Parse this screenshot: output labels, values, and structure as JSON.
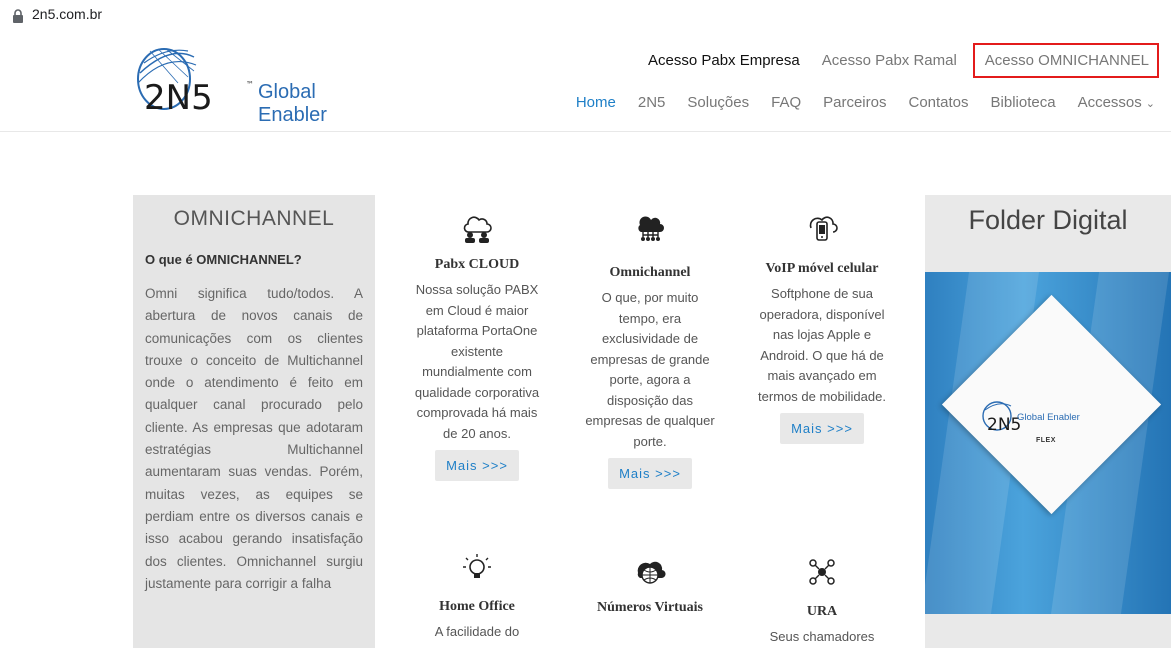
{
  "browser": {
    "url": "2n5.com.br"
  },
  "logo": {
    "brand": "2N5",
    "tagline": "Global Enabler"
  },
  "top_links": [
    "Acesso Pabx Empresa",
    "Acesso Pabx Ramal",
    "Acesso OMNICHANNEL"
  ],
  "nav": [
    "Home",
    "2N5",
    "Soluções",
    "FAQ",
    "Parceiros",
    "Contatos",
    "Biblioteca",
    "Accessos"
  ],
  "left": {
    "title": "OMNICHANNEL",
    "question": "O que é OMNICHANNEL?",
    "body": "Omni significa tudo/todos. A abertura de novos canais de comunicações com os clientes trouxe o conceito de Multichannel onde o atendimento é feito em qualquer canal procurado pelo cliente. As empresas que adotaram estratégias Multichannel aumentaram suas vendas. Porém, muitas vezes, as equipes se perdiam entre os diversos canais e isso acabou gerando insatisfação dos clientes. Omnichannel surgiu justamente para corrigir a falha"
  },
  "cards": [
    {
      "title": "Pabx CLOUD",
      "text": "Nossa solução PABX em Cloud é maior plataforma PortaOne existente mundialmente com qualidade corporativa comprovada há mais de 20 anos.",
      "more": "Mais >>>",
      "icon": "cloud-users-icon"
    },
    {
      "title": "Omnichannel",
      "text": "O que, por muito tempo, era exclusividade de empresas de grande porte, agora a disposição das empresas de qualquer porte.",
      "more": "Mais >>>",
      "icon": "cloud-network-icon"
    },
    {
      "title": "VoIP móvel celular",
      "text": "Softphone de sua operadora, disponível nas lojas Apple e Android. O que há de mais avançado em termos de mobilidade.",
      "more": "Mais >>>",
      "icon": "mobile-cloud-icon"
    },
    {
      "title": "Home Office",
      "text": "A facilidade do",
      "icon": "lightbulb-icon"
    },
    {
      "title": "Números Virtuais",
      "text": "",
      "icon": "globe-cloud-icon"
    },
    {
      "title": "URA",
      "text": "Seus chamadores",
      "icon": "network-nodes-icon"
    }
  ],
  "right": {
    "title": "Folder Digital",
    "folder_tag": "Global Enabler",
    "folder_label": "FLEX"
  }
}
